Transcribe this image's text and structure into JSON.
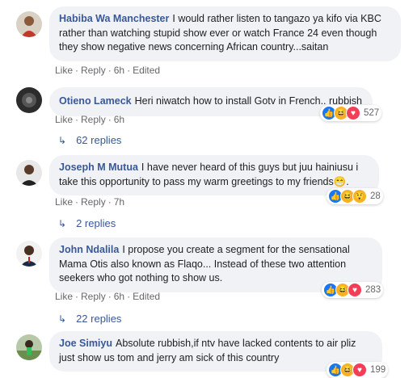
{
  "comments": [
    {
      "author": "Habiba Wa Manchester",
      "text": "I would rather listen to tangazo ya kifo via KBC rather than watching stupid show ever or watch France 24 even though they show negative news concerning African country...saitan",
      "like": "Like",
      "reply": "Reply",
      "time": "6h",
      "edited": "Edited"
    },
    {
      "author": "Otieno Lameck",
      "text": "Heri niwatch how to install Gotv in French.. rubbish",
      "like": "Like",
      "reply": "Reply",
      "time": "6h",
      "reaction_count": "527",
      "replies_label": "62 replies"
    },
    {
      "author": "Joseph M Mutua",
      "text": "I have never heard of this guys but juu hainiusu i take this opportunity to pass my warm greetings to my friends😁.",
      "like": "Like",
      "reply": "Reply",
      "time": "7h",
      "reaction_count": "28",
      "replies_label": "2 replies"
    },
    {
      "author": "John Ndalila",
      "text": "I propose you create a segment for the sensational Mama Otis also known as Flaqo... Instead of these two attention seekers who got nothing to show us.",
      "like": "Like",
      "reply": "Reply",
      "time": "6h",
      "edited": "Edited",
      "reaction_count": "283",
      "replies_label": "22 replies"
    },
    {
      "author": "Joe Simiyu",
      "text": "Absolute rubbish,if ntv have lacked contents to air pliz just show us tom and jerry am sick of this country",
      "reaction_count": "199"
    }
  ],
  "reaction_icons": [
    "like-icon",
    "haha-icon",
    "love-icon"
  ],
  "colors": {
    "link": "#385898",
    "bubble": "#f0f2f5",
    "meta": "#65676b",
    "like": "#1877f2",
    "haha": "#f7b125",
    "love": "#f33e58"
  }
}
